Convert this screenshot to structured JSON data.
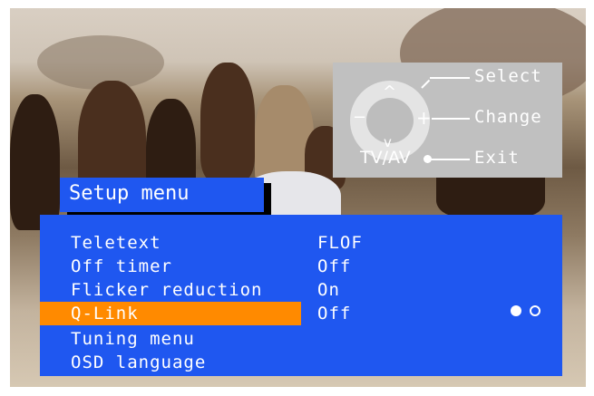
{
  "help": {
    "select_label": "Select",
    "change_label": "Change",
    "exit_label": "Exit",
    "tvav_label": "TV/AV",
    "up_arrow": "^",
    "down_arrow": "v",
    "left_arrow": "−",
    "right_arrow": "+"
  },
  "menu": {
    "title": "Setup menu",
    "items": [
      {
        "label": "Teletext",
        "value": "FLOF"
      },
      {
        "label": "Off timer",
        "value": "Off"
      },
      {
        "label": "Flicker reduction",
        "value": "On"
      },
      {
        "label": "Q-Link",
        "value": "Off"
      },
      {
        "label": "Tuning menu",
        "value": ""
      },
      {
        "label": "OSD language",
        "value": ""
      }
    ],
    "selected_index": 3,
    "page": {
      "current": 1,
      "total": 2
    }
  },
  "colors": {
    "menu_blue": "#1f57f0",
    "highlight_orange": "#ff8a00",
    "help_gray": "#c0c0c0"
  }
}
